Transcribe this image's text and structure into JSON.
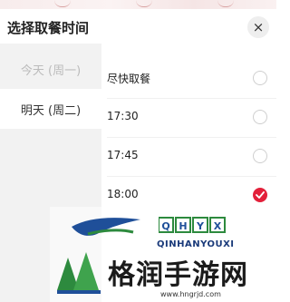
{
  "dialog": {
    "title": "选择取餐时间",
    "close_glyph": "×"
  },
  "days": [
    {
      "label": "今天 (周一)",
      "state": "disabled"
    },
    {
      "label": "明天 (周二)",
      "state": "selected"
    }
  ],
  "times": [
    {
      "label": "尽快取餐",
      "checked": false
    },
    {
      "label": "17:30",
      "checked": false
    },
    {
      "label": "17:45",
      "checked": false
    },
    {
      "label": "18:00",
      "checked": true
    }
  ],
  "colors": {
    "accent": "#e3203a",
    "day_column_bg": "#f2f2f2",
    "disabled_text": "#bbbbbb"
  },
  "watermark": {
    "brand_letters": "QHYX",
    "brand_latin": "QINHANYOUXI",
    "site_name": "格润手游网",
    "url": "www.hngrjd.com"
  }
}
